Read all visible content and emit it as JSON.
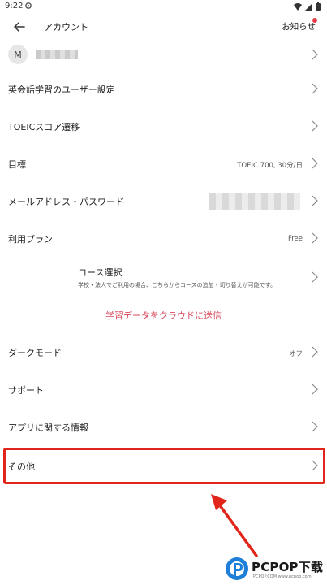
{
  "status_bar": {
    "time": "9:22"
  },
  "app_bar": {
    "title": "アカウント",
    "notice_label": "お知らせ"
  },
  "account": {
    "avatar_initial": "M"
  },
  "menu": {
    "language_settings": "英会話学習のユーザー設定",
    "toeic_history": "TOEICスコア遷移",
    "goal_label": "目標",
    "goal_value": "TOEIC 700, 30分/日",
    "email_password": "メールアドレス・パスワード",
    "plan_label": "利用プラン",
    "plan_value": "Free",
    "course_title": "コース選択",
    "course_desc": "学校・法人でご利用の場合、こちらからコースの追加・切り替えが可能です。",
    "cloud_sync": "学習データをクラウドに送信",
    "dark_mode_label": "ダークモード",
    "dark_mode_value": "オフ",
    "support": "サポート",
    "about_app": "アプリに関する情報",
    "other": "その他"
  },
  "watermark": {
    "brand": "PCPOP下载",
    "sub": "PCPOP.COM  www.pcpop.com"
  },
  "colors": {
    "accent_red": "#e1251b",
    "link_red": "#d9485a",
    "notice_dot": "#e53946"
  }
}
